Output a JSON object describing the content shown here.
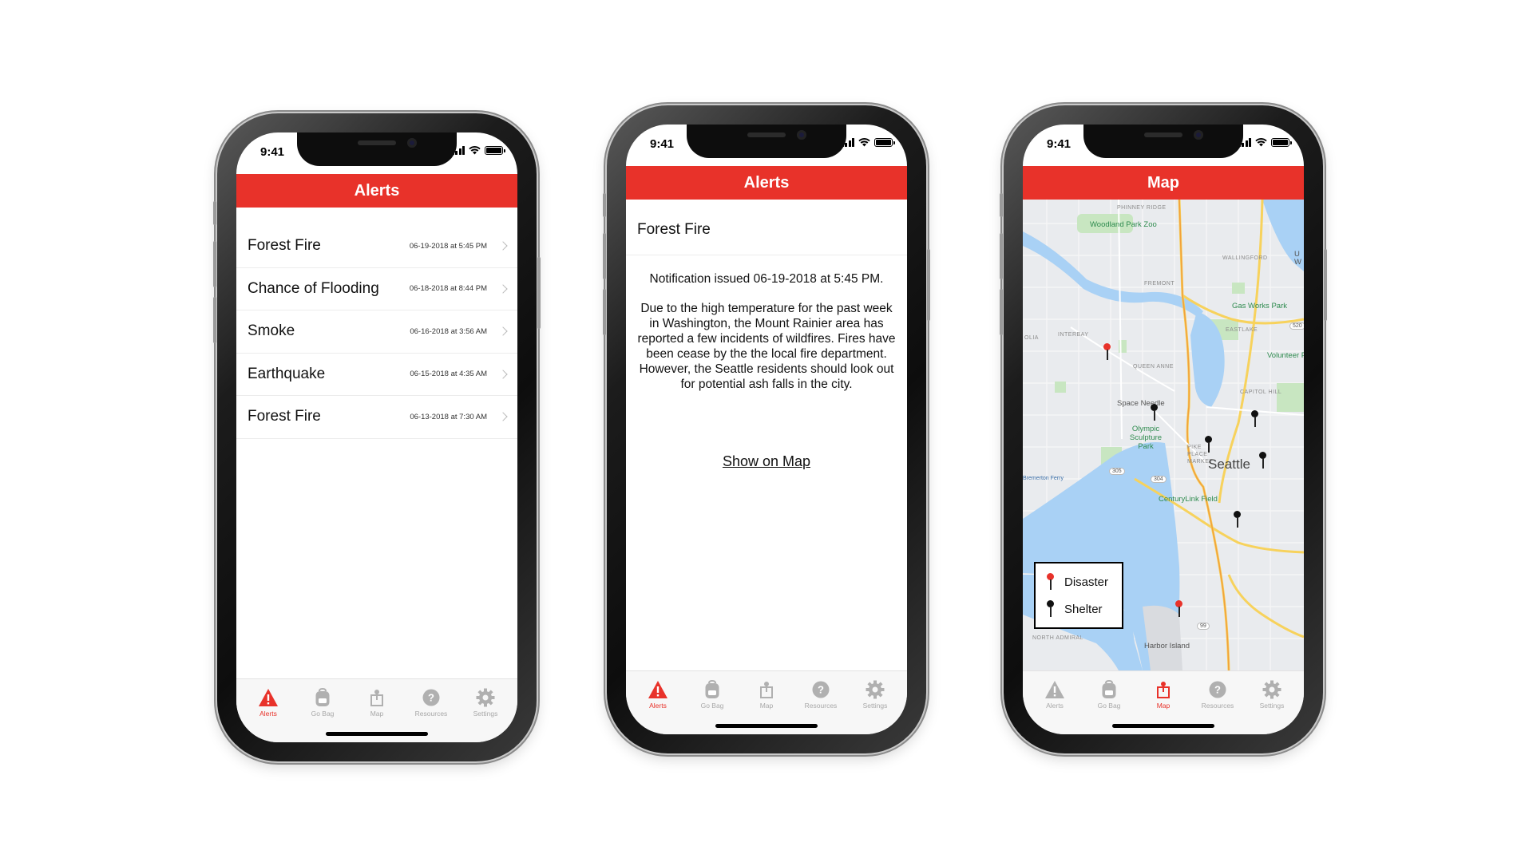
{
  "status": {
    "time": "9:41"
  },
  "tab_bar": {
    "items": [
      {
        "label": "Alerts",
        "icon": "warning-triangle-icon"
      },
      {
        "label": "Go Bag",
        "icon": "backpack-icon"
      },
      {
        "label": "Map",
        "icon": "map-pin-icon"
      },
      {
        "label": "Resources",
        "icon": "question-circle-icon"
      },
      {
        "label": "Settings",
        "icon": "gear-icon"
      }
    ]
  },
  "colors": {
    "accent": "#e8322a",
    "inactive": "#a8a8a8",
    "water": "#a9d1f5",
    "park": "#c8e6c1",
    "highway": "#f7d25c"
  },
  "screen1": {
    "header": "Alerts",
    "alerts": [
      {
        "title": "Forest Fire",
        "date": "06-19-2018 at 5:45 PM"
      },
      {
        "title": "Chance of Flooding",
        "date": "06-18-2018 at 8:44 PM"
      },
      {
        "title": "Smoke",
        "date": "06-16-2018 at 3:56 AM"
      },
      {
        "title": "Earthquake",
        "date": "06-15-2018 at 4:35 AM"
      },
      {
        "title": "Forest Fire",
        "date": "06-13-2018 at 7:30 AM"
      }
    ],
    "active_tab": "Alerts"
  },
  "screen2": {
    "header": "Alerts",
    "title": "Forest Fire",
    "issued": "Notification issued 06-19-2018 at 5:45 PM.",
    "body": "Due to the high temperature for the past week in Washington, the Mount Rainier area has reported a few incidents of wildfires. Fires have been cease by the the local fire department. However, the Seattle residents should look out for potential ash falls in the city.",
    "link": "Show on Map",
    "active_tab": "Alerts"
  },
  "screen3": {
    "header": "Map",
    "active_tab": "Map",
    "map_labels": {
      "phinney_ridge": "PHINNEY RIDGE",
      "woodland_park_zoo": "Woodland Park Zoo",
      "wallingford": "WALLINGFORD",
      "fremont": "FREMONT",
      "gas_works_park": "Gas Works Park",
      "eastlake": "EASTLAKE",
      "interbay": "INTERBAY",
      "olia": "OLIA",
      "queen_anne": "QUEEN ANNE",
      "volunteer_park": "Volunteer Pa",
      "capitol_hill": "CAPITOL HILL",
      "space_needle": "Space Needle",
      "olympic_sculpture_park": "Olympic Sculpture Park",
      "pike_place_market": "PIKE PLACE MARKET",
      "seattle": "Seattle",
      "bremerton_ferry": "Bremerton Ferry",
      "centurylink_field": "CenturyLink Field",
      "north_admiral": "NORTH ADMIRAL",
      "harbor_island": "Harbor Island",
      "uw": "U W",
      "shield_305": "305",
      "shield_304": "304",
      "shield_520": "520",
      "shield_99": "99"
    },
    "legend": {
      "disaster_label": "Disaster",
      "shelter_label": "Shelter"
    }
  }
}
